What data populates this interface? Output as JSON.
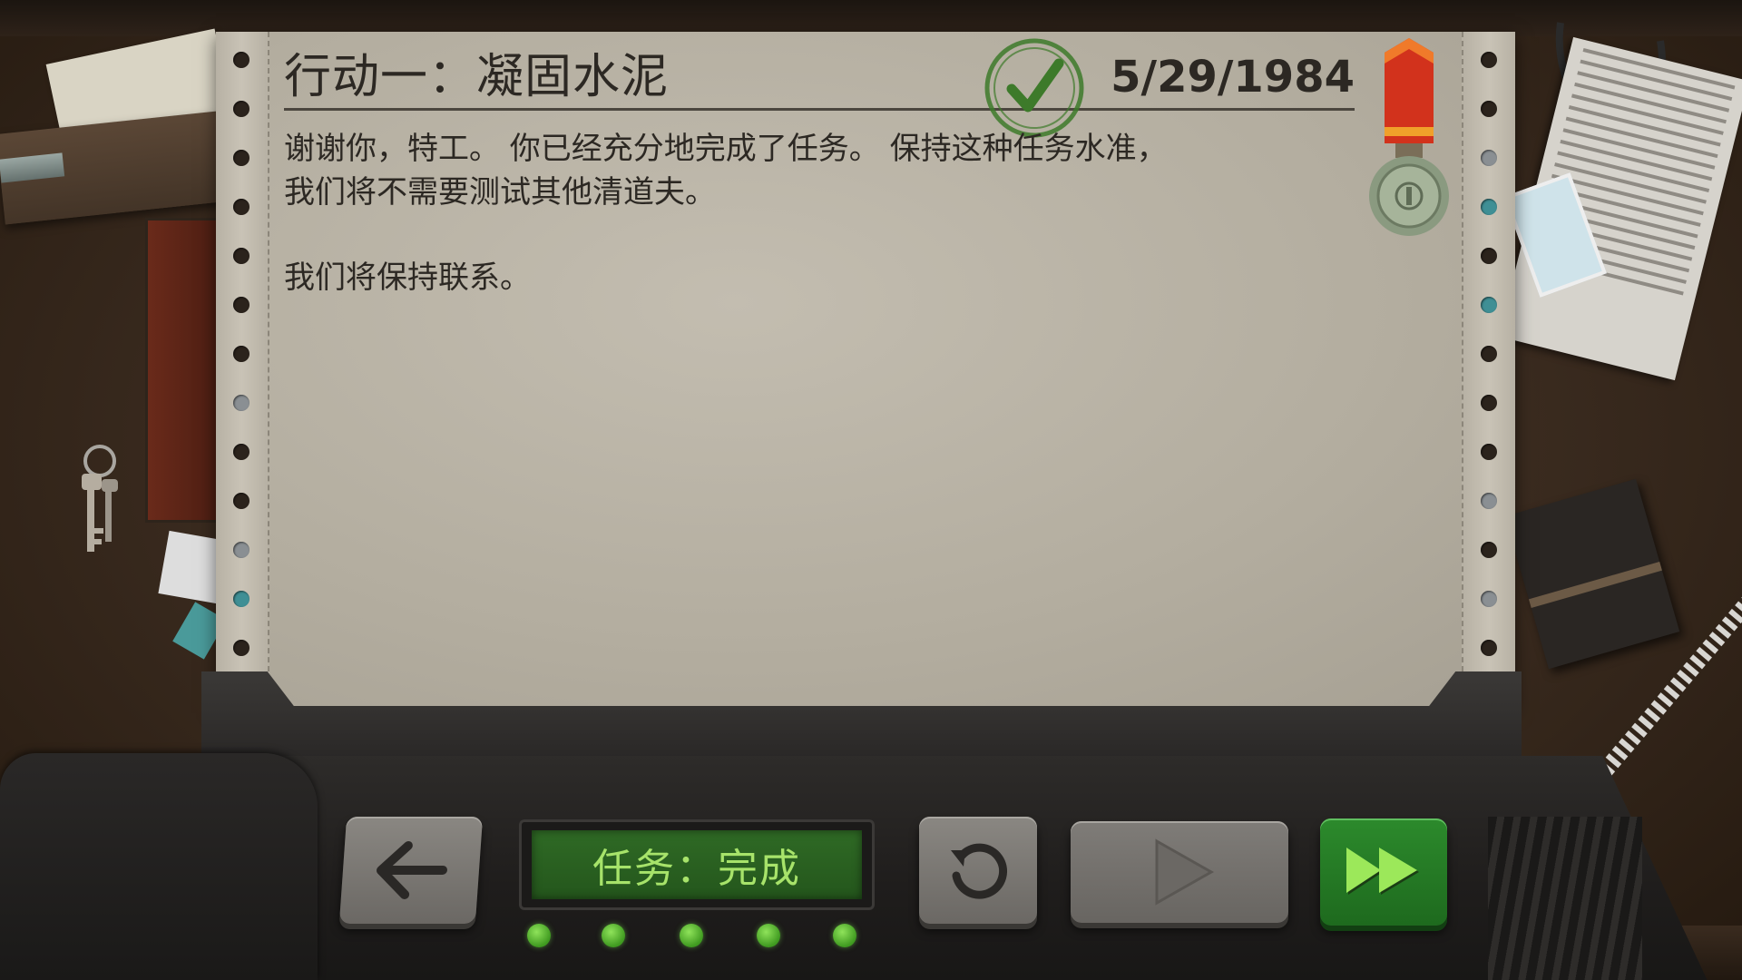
{
  "report": {
    "title": "行动一：凝固水泥",
    "date": "5/29/1984",
    "status_stamp_icon": "checkmark-stamp-icon",
    "medal_icon": "medal-icon",
    "body_lines": [
      "谢谢你，特工。 你已经充分地完成了任务。 保持这种任务水准，",
      "我们将不需要测试其他清道夫。",
      "我们将保持联系。"
    ]
  },
  "console": {
    "status_display": "任务：完成",
    "progress_dots": 5,
    "buttons": {
      "back_icon": "arrow-left-icon",
      "restart_icon": "restart-icon",
      "play_icon": "play-icon",
      "fast_forward_icon": "fast-forward-icon"
    },
    "accent_colors": {
      "display_text": "#a7e36a",
      "fast_forward": "#2c8a2c",
      "stamp": "#3d7a2a",
      "medal_ribbon": "#d2321c"
    }
  }
}
